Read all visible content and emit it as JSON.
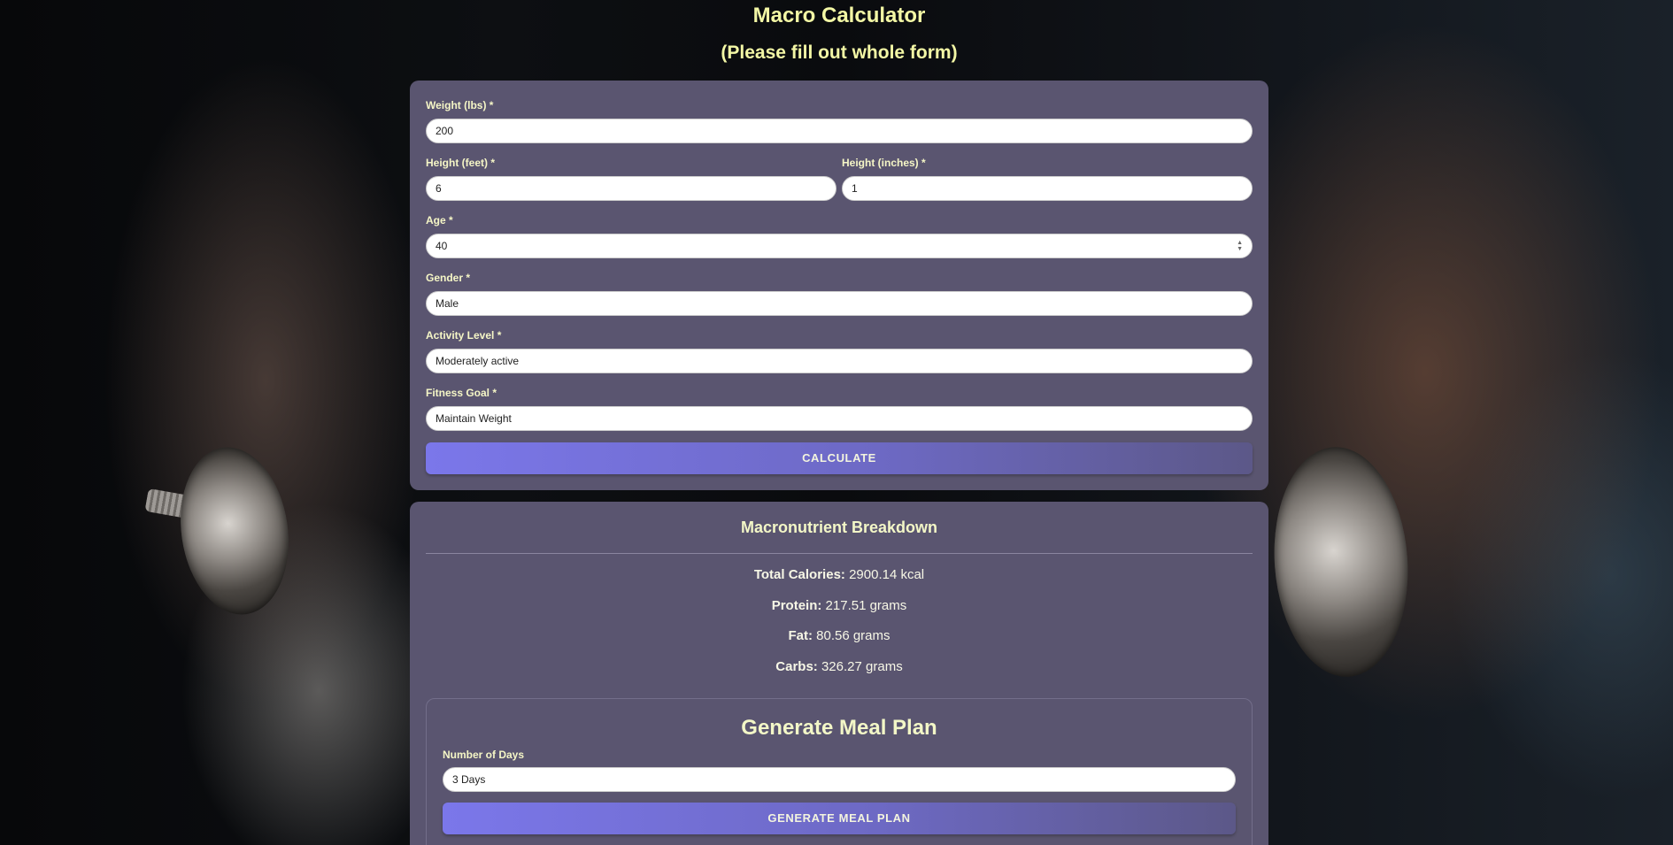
{
  "header": {
    "title": "Macro Calculator",
    "subtitle": "(Please fill out whole form)"
  },
  "form": {
    "weight": {
      "label": "Weight (lbs) *",
      "value": "200"
    },
    "height_feet": {
      "label": "Height (feet) *",
      "value": "6"
    },
    "height_inches": {
      "label": "Height (inches) *",
      "value": "1"
    },
    "age": {
      "label": "Age *",
      "value": "40"
    },
    "gender": {
      "label": "Gender *",
      "value": "Male"
    },
    "activity": {
      "label": "Activity Level *",
      "value": "Moderately active"
    },
    "goal": {
      "label": "Fitness Goal *",
      "value": "Maintain Weight"
    },
    "calculate_label": "CALCULATE"
  },
  "results": {
    "title": "Macronutrient Breakdown",
    "stats": [
      {
        "label": "Total Calories:",
        "value": "2900.14 kcal"
      },
      {
        "label": "Protein:",
        "value": "217.51 grams"
      },
      {
        "label": "Fat:",
        "value": "80.56 grams"
      },
      {
        "label": "Carbs:",
        "value": "326.27 grams"
      }
    ]
  },
  "meal_plan": {
    "title": "Generate Meal Plan",
    "days_label": "Number of Days",
    "days_value": "3 Days",
    "button_label": "GENERATE MEAL PLAN"
  }
}
